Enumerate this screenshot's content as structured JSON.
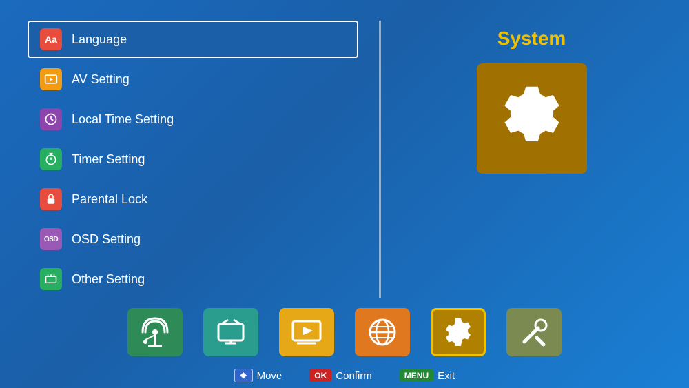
{
  "title": "System",
  "menu": {
    "items": [
      {
        "id": "language",
        "label": "Language",
        "icon": "Aa",
        "iconClass": "icon-language",
        "active": true
      },
      {
        "id": "av-setting",
        "label": "AV Setting",
        "icon": "av",
        "iconClass": "icon-av",
        "active": false
      },
      {
        "id": "local-time",
        "label": "Local Time Setting",
        "icon": "globe",
        "iconClass": "icon-time",
        "active": false
      },
      {
        "id": "timer",
        "label": "Timer Setting",
        "icon": "clock",
        "iconClass": "icon-timer",
        "active": false
      },
      {
        "id": "parental",
        "label": "Parental Lock",
        "icon": "lock",
        "iconClass": "icon-parental",
        "active": false
      },
      {
        "id": "osd",
        "label": "OSD Setting",
        "icon": "OSD",
        "iconClass": "icon-osd",
        "active": false
      },
      {
        "id": "other",
        "label": "Other Setting",
        "icon": "box",
        "iconClass": "icon-other",
        "active": false
      }
    ]
  },
  "statusBar": {
    "moveLabel": "Move",
    "moveBadge": "◆",
    "confirmLabel": "Confirm",
    "confirmBadge": "OK",
    "exitLabel": "Exit",
    "exitBadge": "MENU"
  },
  "bottomNav": [
    {
      "id": "satellite",
      "label": "Satellite"
    },
    {
      "id": "tv",
      "label": "TV"
    },
    {
      "id": "player",
      "label": "Player"
    },
    {
      "id": "internet",
      "label": "Internet"
    },
    {
      "id": "system",
      "label": "System"
    },
    {
      "id": "tools",
      "label": "Tools"
    }
  ]
}
